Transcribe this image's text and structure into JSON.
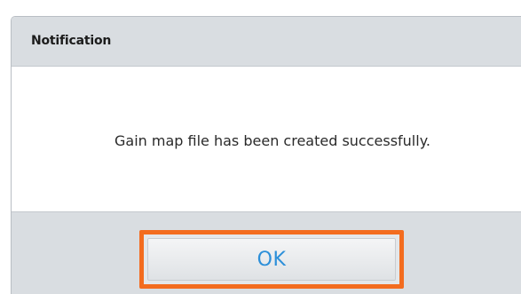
{
  "dialog": {
    "title": "Notification",
    "message": "Gain map file has been created successfully.",
    "ok_label": "OK"
  },
  "colors": {
    "highlight": "#f36c1f",
    "ok_text": "#2c8fd9",
    "chrome": "#d9dde1"
  }
}
